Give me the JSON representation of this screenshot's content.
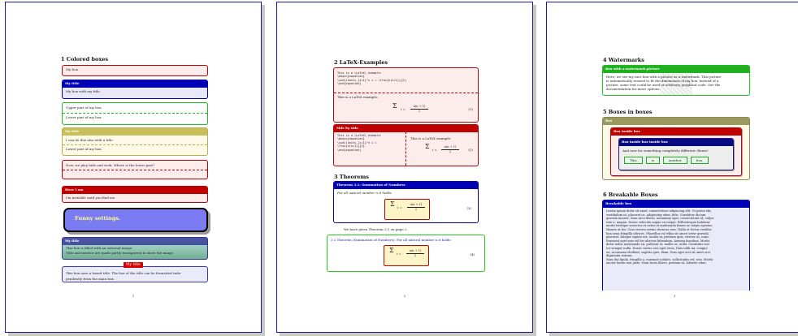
{
  "page1": {
    "section": "1   Colored boxes",
    "box1": "My box.",
    "box2_title": "My title",
    "box2_body": "My box with my title.",
    "box3_upper": "Upper part of my box.",
    "box3_lower": "Lower part of my box.",
    "box4_title": "My title",
    "box4_upper": "I can do this also with a title.",
    "box4_lower": "Lower part of my box.",
    "box5": "Now, we play hide and seek. Where is the lower part?",
    "box6_title": "Here I am",
    "box6_body": "I'm invisible until you find me.",
    "box7": "Funny settings.",
    "box8_title": "My title",
    "box8_body_1": "This box is filled with an external image.",
    "box8_body_2": "Title and interior are made partly transparent to show the image.",
    "box9_title": "My title",
    "box9_body_1": "This box uses a boxed title. The box of the title can be formatted inde-",
    "box9_body_2": "pendently from the main box.",
    "page_number": "1"
  },
  "page2": {
    "section": "2   LaTeX-Examples",
    "ex_code": [
      "This is a \\LaTeX\\ example:",
      "\\begin{equation}",
      "\\sum\\limits_{i=1}^n i = \\frac{n(n+1)}{2}.",
      "\\end{equation}"
    ],
    "ex_result": "This is a LaTeX example:",
    "eq_number_1": "(1)",
    "sbs_title": "Side by side",
    "sbs_code": [
      "This is a \\LaTeX\\ example:",
      "\\begin{equation}",
      "\\sum\\limits_{i=1}^n i =",
      "     \\frac{n(n+1)}{2}.",
      "\\end{equation}"
    ],
    "sbs_result": "This is a LaTeX example:",
    "eq_number_2": "(2)",
    "section_theorems": "3   Theorems",
    "thm1_title": "Theorem 3.1: Summation of Numbers",
    "thm1_body": "For all natural number n it holds:",
    "eq_number_3": "(3)",
    "ref_text": "We have given Theorem 3.1 on page 2.",
    "thm2_head": "3.2 Theorem (Summation of Numbers): For all natural number n it holds:",
    "eq_number_4": "(4)",
    "formula_sum": "Σ",
    "formula_rhs_top": "n(n + 1)",
    "formula_rhs_bottom": "2",
    "formula_lhs": "i =",
    "page_number": "2"
  },
  "page3": {
    "section_watermarks": "4   Watermarks",
    "wm_title": "Box with a watermark picture",
    "wm_body": [
      "Here, we see my nice box with a picture as a watermark. This picture",
      "is automatically resized to fit the dimensions of my box. Instead of a",
      "picture, some text could be used or arbitrary graphical code. See the",
      "documentation for more options."
    ],
    "section_boxes": "5   Boxes in boxes",
    "outer_title": "Box",
    "inner_title": "Box inside box",
    "inner2_title": "Box inside box inside box",
    "inner2_body": "And now for something completely different: Boxes!",
    "tiny_boxes": [
      "This",
      "is",
      "another",
      "box."
    ],
    "section_breakable": "6   Breakable Boxes",
    "brk_title": "Breakable box",
    "brk_lines": [
      "Lorem ipsum dolor sit amet, consectetuer adipiscing elit. Ut purus elit,",
      "vestibulum ut, placerat ac, adipiscing vitae, felis. Curabitur dictum",
      "gravida mauris. Nam arcu libero, nonummy eget, consectetuer id, vulpu-",
      "tate a, magna. Donec vehicula augue eu neque. Pellentesque habitant",
      "morbi tristique senectus et netus et malesuada fames ac turpis egestas.",
      "Mauris ut leo. Cras viverra metus rhoncus sem. Nulla et lectus vestibu-",
      "lum urna fringilla ultrices. Phasellus eu tellus sit amet tortor gravida",
      "placerat. Integer sapien est, iaculis in, pretium quis, viverra ac, nunc.",
      "Praesent eget sem vel leo ultrices bibendum. Aenean faucibus. Morbi",
      "dolor nulla, malesuada eu, pulvinar at, mollis ac, nulla. Curabitur auc-",
      "tor semper nulla. Donec varius orci eget risus. Duis nibh mi, congue",
      "eu, accumsan eleifend, sagittis quis, diam. Duis eget orci sit amet orci",
      "dignissim rutrum.",
      "Nam dui ligula, fringilla a, euismod sodales, sollicitudin vel, wisi. Morbi",
      "auctor lorem non justo. Nam lacus libero, pretium at, lobortis vitae,"
    ],
    "page_number": "3"
  }
}
